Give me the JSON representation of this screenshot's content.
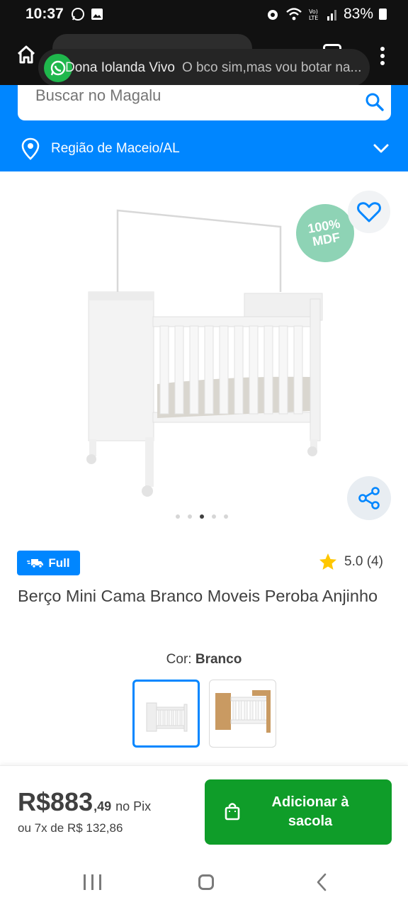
{
  "status_bar": {
    "time": "10:37",
    "battery": "83%",
    "left_icons": [
      "whatsapp-icon",
      "image-icon"
    ],
    "right_icons": [
      "alarm-icon",
      "wifi-icon",
      "volte-icon",
      "signal-icon",
      "battery-icon"
    ]
  },
  "notification": {
    "sender": "Dona Iolanda Vivo",
    "message": "O bco sim,mas vou botar na..."
  },
  "header": {
    "search_placeholder": "Buscar no Magalu",
    "region": "Região de Maceio/AL"
  },
  "product": {
    "badge_line1": "100%",
    "badge_line2": "MDF",
    "image_dots": 5,
    "active_dot": 3,
    "shipping_badge": "Full",
    "rating": "5.0 (4)",
    "title": "Berço Mini Cama Branco Moveis Peroba Anjinho",
    "color_label": "Cor:",
    "color_value": "Branco",
    "variants": [
      "Branco",
      "Madeira"
    ]
  },
  "purchase": {
    "price_main": "R$883",
    "price_cents": ",49",
    "price_suffix": "no Pix",
    "installments": "ou 7x de R$ 132,86",
    "add_button_line1": "Adicionar à",
    "add_button_line2": "sacola"
  },
  "colors": {
    "brand_blue": "#0086ff",
    "buy_green": "#0f9d29"
  }
}
